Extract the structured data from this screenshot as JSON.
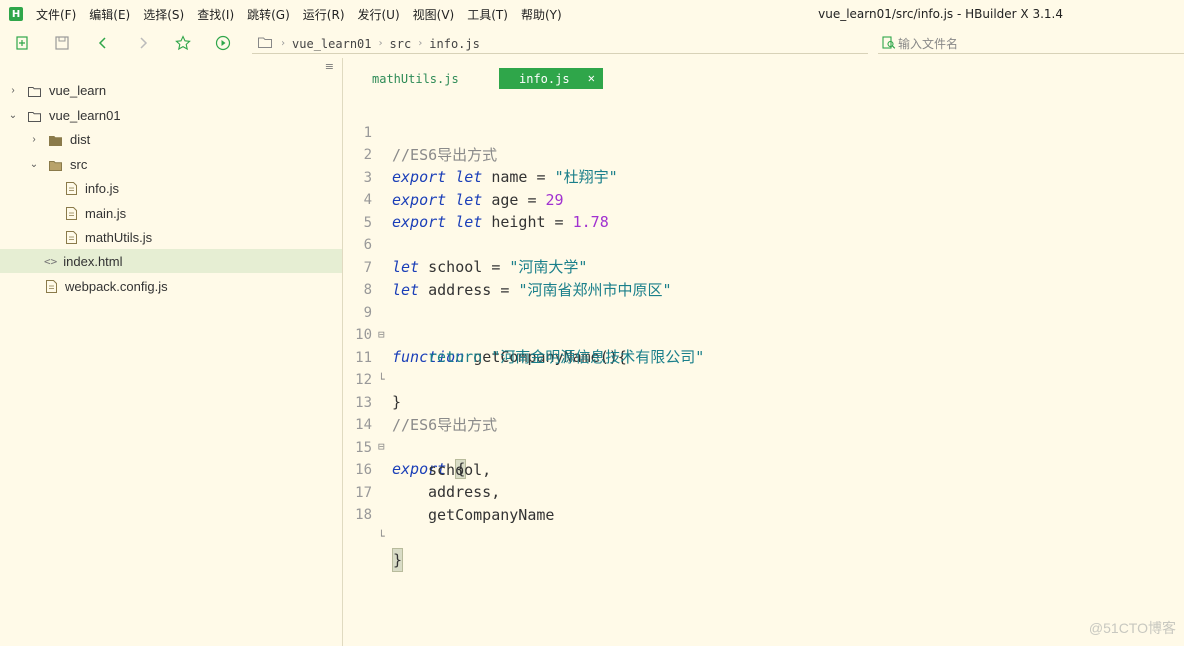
{
  "app": {
    "logo_text": "H",
    "window_title": "vue_learn01/src/info.js - HBuilder X 3.1.4",
    "accent_color": "#2fa64a",
    "background_color": "#fffae8"
  },
  "menu": [
    "文件(F)",
    "编辑(E)",
    "选择(S)",
    "查找(I)",
    "跳转(G)",
    "运行(R)",
    "发行(U)",
    "视图(V)",
    "工具(T)",
    "帮助(Y)"
  ],
  "toolbar": {
    "icons": [
      "new-file-icon",
      "save-icon",
      "back-icon",
      "forward-icon",
      "star-icon",
      "run-icon"
    ],
    "breadcrumb": [
      "vue_learn01",
      "src",
      "info.js"
    ],
    "file_search_placeholder": "输入文件名"
  },
  "sidebar": {
    "items": [
      {
        "label": "vue_learn",
        "type": "folder",
        "expanded": false
      },
      {
        "label": "vue_learn01",
        "type": "folder",
        "expanded": true
      },
      {
        "label": "dist",
        "type": "folder",
        "expanded": false
      },
      {
        "label": "src",
        "type": "folder",
        "expanded": true
      },
      {
        "label": "info.js",
        "type": "file"
      },
      {
        "label": "main.js",
        "type": "file"
      },
      {
        "label": "mathUtils.js",
        "type": "file"
      },
      {
        "label": "index.html",
        "type": "html",
        "selected": true
      },
      {
        "label": "webpack.config.js",
        "type": "file"
      }
    ]
  },
  "editor": {
    "tabs": [
      {
        "label": "mathUtils.js",
        "active": false
      },
      {
        "label": "info.js",
        "active": true,
        "close": "✕"
      }
    ],
    "line_numbers": [
      "1",
      "2",
      "3",
      "4",
      "5",
      "6",
      "7",
      "8",
      "9",
      "10",
      "11",
      "12",
      "13",
      "14",
      "15",
      "16",
      "17",
      "18"
    ],
    "code": {
      "l1": "//ES6导出方式",
      "l2_kw1": "export",
      "l2_kw2": "let",
      "l2_rest": " name = ",
      "l2_str": "\"杜翔宇\"",
      "l3_kw1": "export",
      "l3_kw2": "let",
      "l3_rest": " age = ",
      "l3_num": "29",
      "l4_kw1": "export",
      "l4_kw2": "let",
      "l4_rest": " height = ",
      "l4_num": "1.78",
      "l6_kw": "let",
      "l6_rest": " school = ",
      "l6_str": "\"河南大学\"",
      "l7_kw": "let",
      "l7_rest": " address = ",
      "l7_str": "\"河南省郑州市中原区\"",
      "l9_kw": "function",
      "l9_rest": " getCompanyName(){",
      "l10_kw": "return",
      "l10_str": "\"河南金明源信息技术有限公司\"",
      "l11": "}",
      "l13": "//ES6导出方式",
      "l14_kw": "export",
      "l14_brace": "{",
      "l15": "school,",
      "l16": "address,",
      "l17": "getCompanyName",
      "l18": "}"
    }
  },
  "watermark": "@51CTO博客"
}
